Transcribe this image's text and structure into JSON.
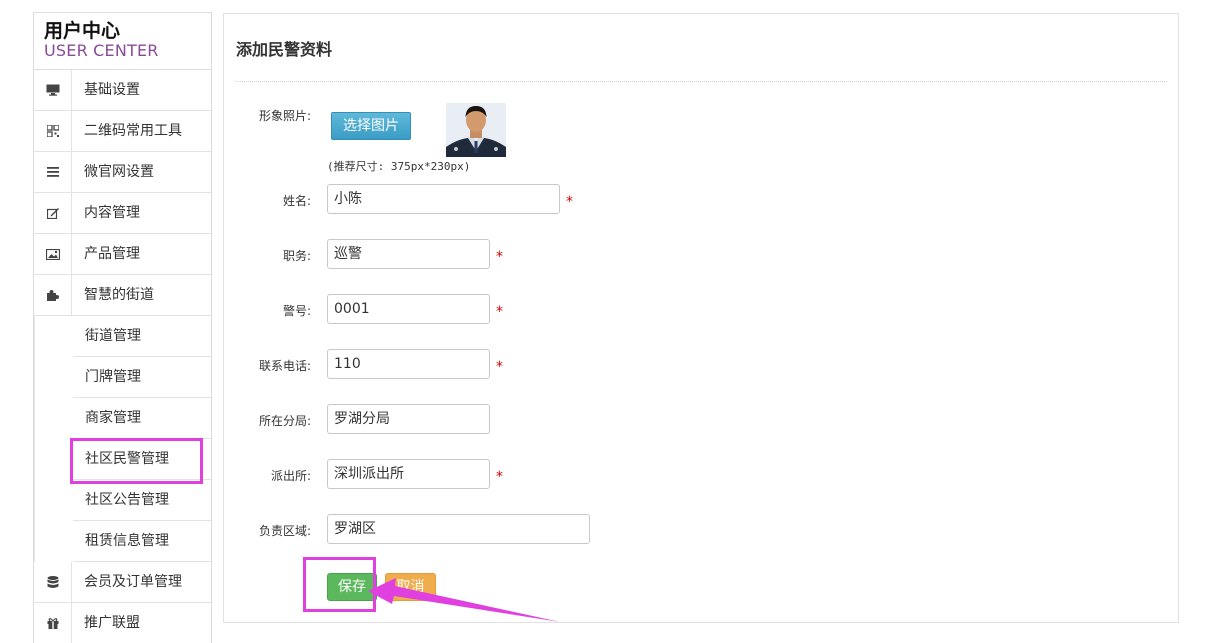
{
  "sidebar": {
    "title": "用户中心",
    "subtitle": "USER CENTER",
    "items": [
      {
        "label": "基础设置",
        "icon": "monitor-icon"
      },
      {
        "label": "二维码常用工具",
        "icon": "qrcode-icon"
      },
      {
        "label": "微官网设置",
        "icon": "menu-icon"
      },
      {
        "label": "内容管理",
        "icon": "edit-icon"
      },
      {
        "label": "产品管理",
        "icon": "image-icon"
      },
      {
        "label": "智慧的街道",
        "icon": "puzzle-icon"
      }
    ],
    "sub_items": [
      {
        "label": "街道管理"
      },
      {
        "label": "门牌管理"
      },
      {
        "label": "商家管理"
      },
      {
        "label": "社区民警管理"
      },
      {
        "label": "社区公告管理"
      },
      {
        "label": "租赁信息管理"
      }
    ],
    "bottom_items": [
      {
        "label": "会员及订单管理",
        "icon": "database-icon"
      },
      {
        "label": "推广联盟",
        "icon": "gift-icon"
      }
    ],
    "highlight_color": "#e040e0"
  },
  "form": {
    "title": "添加民警资料",
    "photo_label": "形象照片:",
    "pick_button": "选择图片",
    "hint": "(推荐尺寸: 375px*230px)",
    "fields": [
      {
        "label": "姓名:",
        "value": "小陈",
        "required": true
      },
      {
        "label": "职务:",
        "value": "巡警",
        "required": true
      },
      {
        "label": "警号:",
        "value": "0001",
        "required": true
      },
      {
        "label": "联系电话:",
        "value": "110",
        "required": true
      },
      {
        "label": "所在分局:",
        "value": "罗湖分局",
        "required": false
      },
      {
        "label": "派出所:",
        "value": "深圳派出所",
        "required": true
      },
      {
        "label": "负责区域:",
        "value": "罗湖区",
        "required": false
      }
    ],
    "required_mark": "*",
    "save_button": "保存",
    "cancel_button": "取消",
    "colors": {
      "save": "#5cb85c",
      "cancel": "#f0ad4e",
      "pick": "#3a9cc6",
      "required": "#dd0000"
    }
  }
}
